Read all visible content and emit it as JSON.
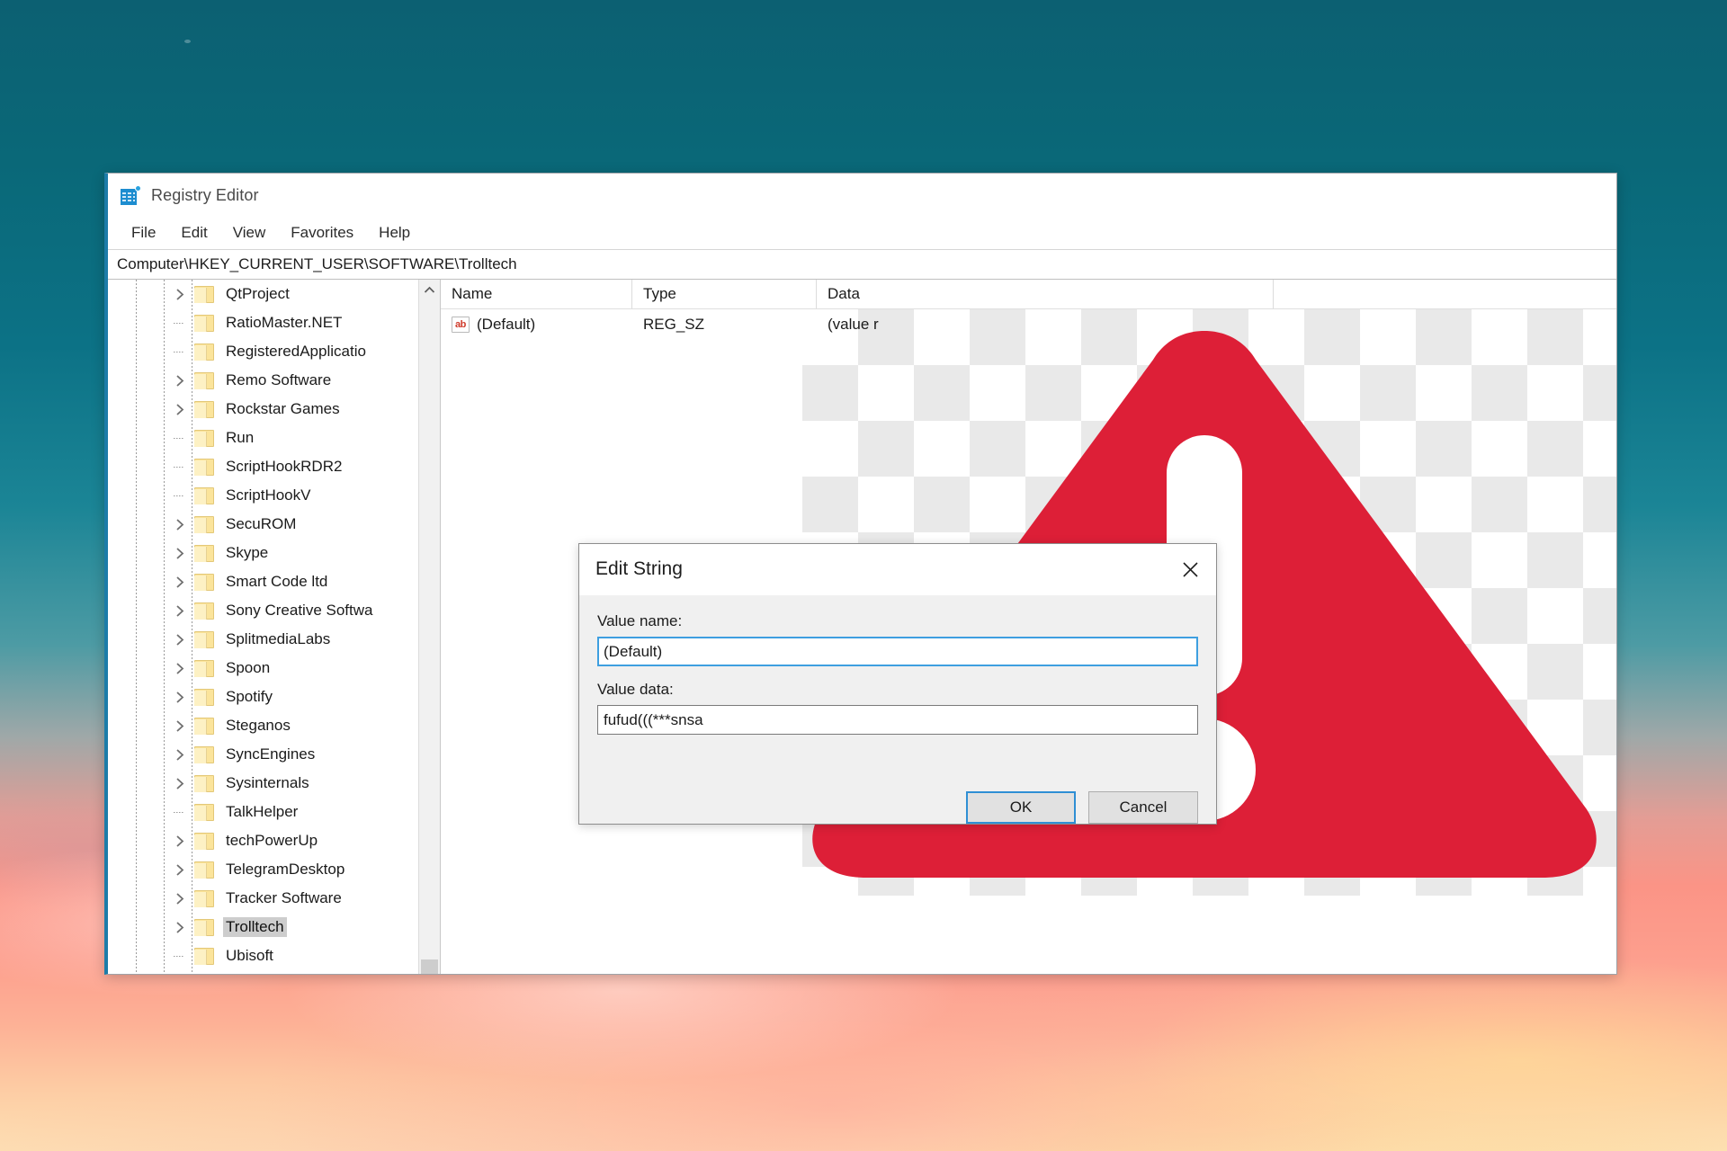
{
  "window": {
    "title": "Registry Editor",
    "icon": "registry-editor-icon",
    "menu": [
      "File",
      "Edit",
      "View",
      "Favorites",
      "Help"
    ],
    "address": "Computer\\HKEY_CURRENT_USER\\SOFTWARE\\Trolltech"
  },
  "tree": {
    "scroll_up_icon": "chevron-up-icon",
    "items": [
      {
        "label": "QtProject",
        "expandable": true,
        "selected": false
      },
      {
        "label": "RatioMaster.NET",
        "expandable": false,
        "selected": false
      },
      {
        "label": "RegisteredApplicatio",
        "expandable": false,
        "selected": false
      },
      {
        "label": "Remo Software",
        "expandable": true,
        "selected": false
      },
      {
        "label": "Rockstar Games",
        "expandable": true,
        "selected": false
      },
      {
        "label": "Run",
        "expandable": false,
        "selected": false
      },
      {
        "label": "ScriptHookRDR2",
        "expandable": false,
        "selected": false
      },
      {
        "label": "ScriptHookV",
        "expandable": false,
        "selected": false
      },
      {
        "label": "SecuROM",
        "expandable": true,
        "selected": false
      },
      {
        "label": "Skype",
        "expandable": true,
        "selected": false
      },
      {
        "label": "Smart Code ltd",
        "expandable": true,
        "selected": false
      },
      {
        "label": "Sony Creative Softwa",
        "expandable": true,
        "selected": false
      },
      {
        "label": "SplitmediaLabs",
        "expandable": true,
        "selected": false
      },
      {
        "label": "Spoon",
        "expandable": true,
        "selected": false
      },
      {
        "label": "Spotify",
        "expandable": true,
        "selected": false
      },
      {
        "label": "Steganos",
        "expandable": true,
        "selected": false
      },
      {
        "label": "SyncEngines",
        "expandable": true,
        "selected": false
      },
      {
        "label": "Sysinternals",
        "expandable": true,
        "selected": false
      },
      {
        "label": "TalkHelper",
        "expandable": false,
        "selected": false
      },
      {
        "label": "techPowerUp",
        "expandable": true,
        "selected": false
      },
      {
        "label": "TelegramDesktop",
        "expandable": true,
        "selected": false
      },
      {
        "label": "Tracker Software",
        "expandable": true,
        "selected": false
      },
      {
        "label": "Trolltech",
        "expandable": true,
        "selected": true
      },
      {
        "label": "Ubisoft",
        "expandable": false,
        "selected": false
      }
    ]
  },
  "values": {
    "columns": [
      "Name",
      "Type",
      "Data"
    ],
    "rows": [
      {
        "icon": "string-value-icon",
        "name": "(Default)",
        "type": "REG_SZ",
        "data": "(value r"
      }
    ]
  },
  "overlay_image": {
    "name": "warning-triangle-image",
    "red": "#dd1f37"
  },
  "dialog": {
    "title": "Edit String",
    "close_icon": "close-icon",
    "value_name_label": "Value name:",
    "value_name": "(Default)",
    "value_data_label": "Value data:",
    "value_data": "fufud(((***snsa",
    "ok_label": "OK",
    "cancel_label": "Cancel"
  }
}
